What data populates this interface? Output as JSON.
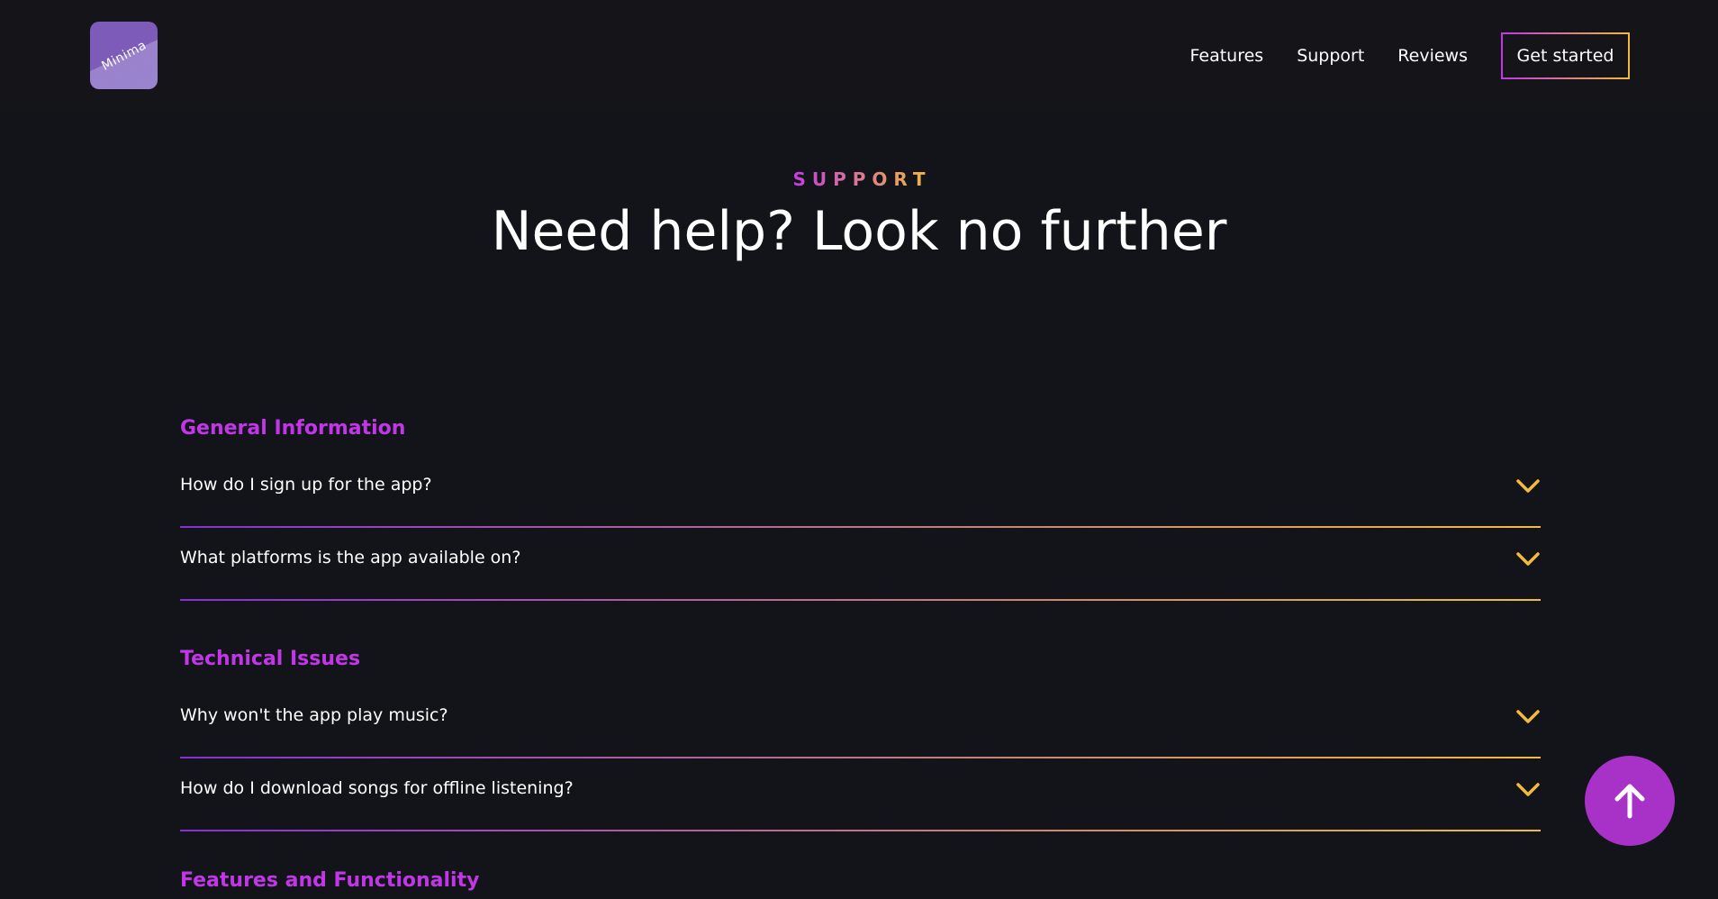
{
  "brand": {
    "logo_text": "Minima"
  },
  "nav": {
    "links": [
      "Features",
      "Support",
      "Reviews"
    ],
    "cta_label": "Get started"
  },
  "hero": {
    "eyebrow": "SUPPORT",
    "title": "Need help? Look no further"
  },
  "faq": {
    "groups": [
      {
        "title": "General Information",
        "questions": [
          "How do I sign up for the app?",
          "What platforms is the app available on?"
        ]
      },
      {
        "title": "Technical Issues",
        "questions": [
          "Why won't the app play music?",
          "How do I download songs for offline listening?"
        ]
      },
      {
        "title": "Features and Functionality",
        "questions": []
      }
    ]
  },
  "icons": {
    "chevron": "chevron-down-icon",
    "scroll_top": "arrow-up-icon"
  },
  "colors": {
    "background": "#13131a",
    "accent_purple": "#c137e8",
    "accent_gold": "#f2bb3a",
    "scroll_button": "#a832c8"
  }
}
